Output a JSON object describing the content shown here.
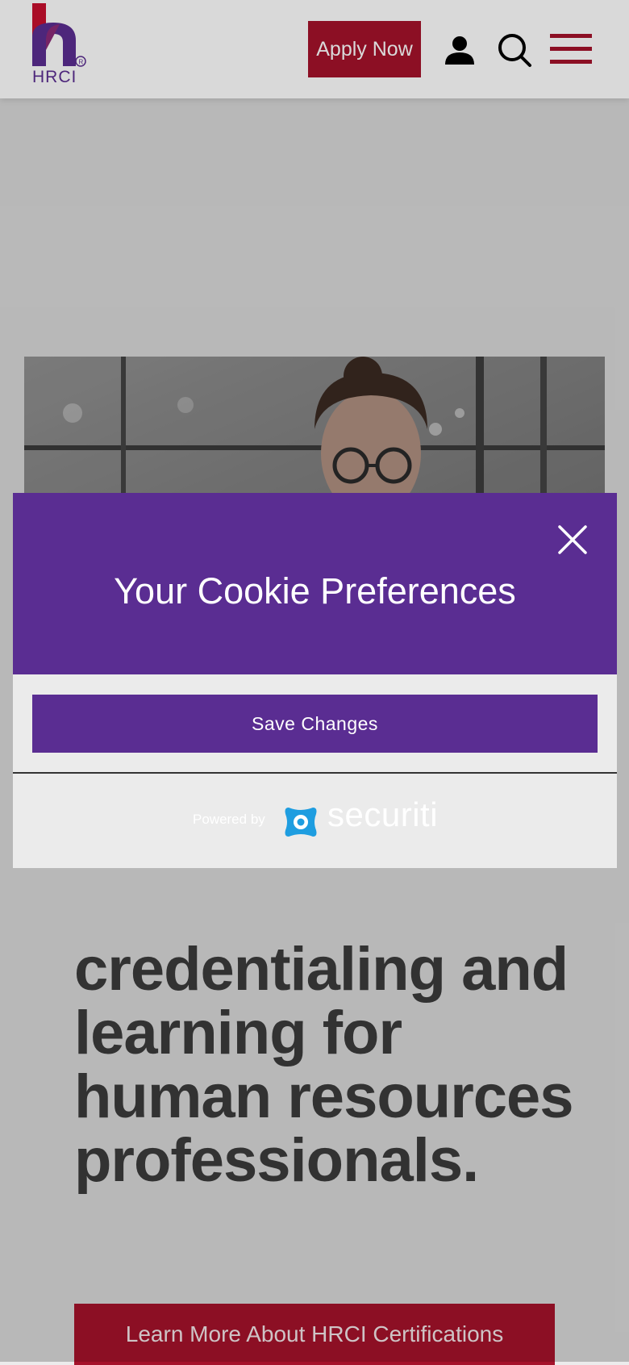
{
  "header": {
    "logo_text": "HRCI",
    "apply_label": "Apply Now",
    "icons": [
      "account-icon",
      "search-icon",
      "menu-icon"
    ]
  },
  "main": {
    "headline": "credentialing and learning for human resources professionals.",
    "cta_label": "Learn More About HRCI Certifications"
  },
  "cookie_modal": {
    "title": "Your Cookie Preferences",
    "save_label": "Save Changes",
    "powered_by": "Powered by",
    "provider": "securiti"
  },
  "colors": {
    "brand_purple": "#5a2d92",
    "brand_red": "#a5122b",
    "provider_blue": "#1e9de0"
  }
}
